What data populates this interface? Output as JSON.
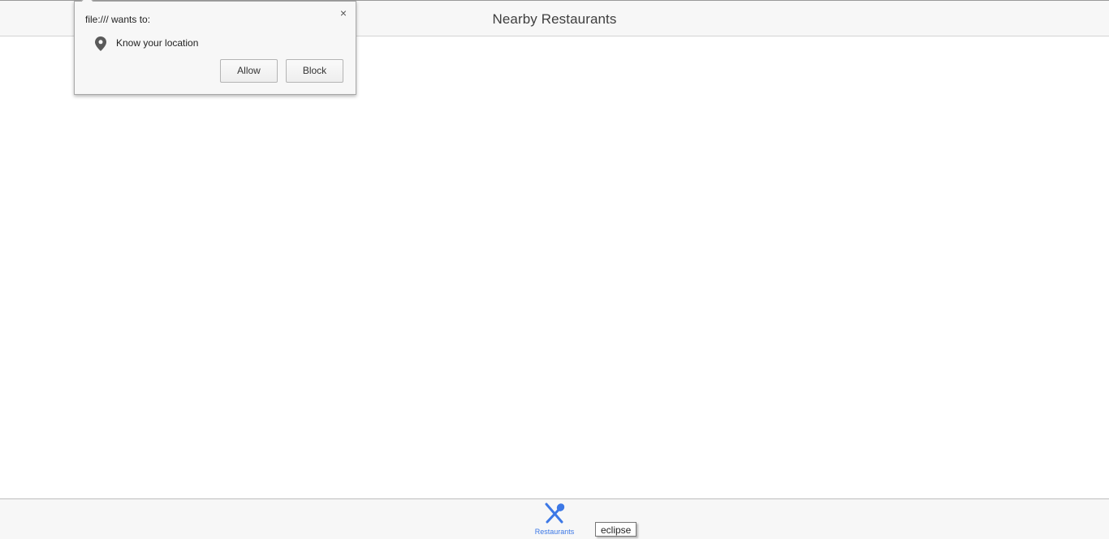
{
  "header": {
    "title": "Nearby Restaurants"
  },
  "permission_popup": {
    "origin_text": "file:/// wants to:",
    "permission": "Know your location",
    "close_glyph": "×",
    "allow_label": "Allow",
    "block_label": "Block",
    "icons": {
      "permission": "location-pin-icon",
      "close": "close-icon"
    }
  },
  "tab_bar": {
    "tabs": [
      {
        "label": "Restaurants",
        "icon": "fork-spoon-icon",
        "active": true
      }
    ]
  },
  "tooltip": {
    "text": "eclipse"
  },
  "colors": {
    "accent": "#3c78e6",
    "bar_background": "#f7f7f7",
    "title_text": "#3e3e3e"
  }
}
